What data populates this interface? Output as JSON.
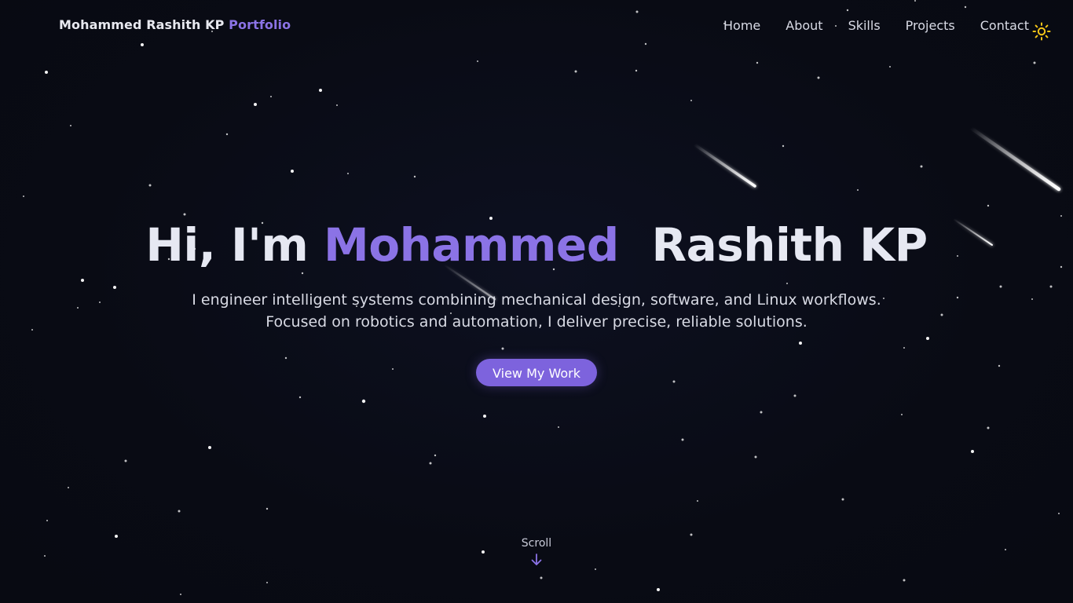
{
  "header": {
    "brand_name": "Mohammed Rashith KP",
    "brand_accent": "Portfolio",
    "nav": [
      {
        "label": "Home"
      },
      {
        "label": "About"
      },
      {
        "label": "Skills"
      },
      {
        "label": "Projects"
      },
      {
        "label": "Contact"
      }
    ],
    "theme_toggle_icon": "sun-icon"
  },
  "hero": {
    "greeting": "Hi, I'm",
    "first_name": "Mohammed",
    "last_name": "Rashith KP",
    "subtitle_line1": "I engineer intelligent systems combining mechanical design, software, and Linux workflows.",
    "subtitle_line2": "Focused on robotics and automation, I deliver precise, reliable solutions.",
    "cta_label": "View My Work"
  },
  "scroll": {
    "label": "Scroll",
    "icon": "arrow-down-icon"
  },
  "colors": {
    "background": "#090b14",
    "accent": "#8b73e6",
    "button": "#7d63dd",
    "text": "#e6e8f2",
    "sun": "#f5c518"
  }
}
